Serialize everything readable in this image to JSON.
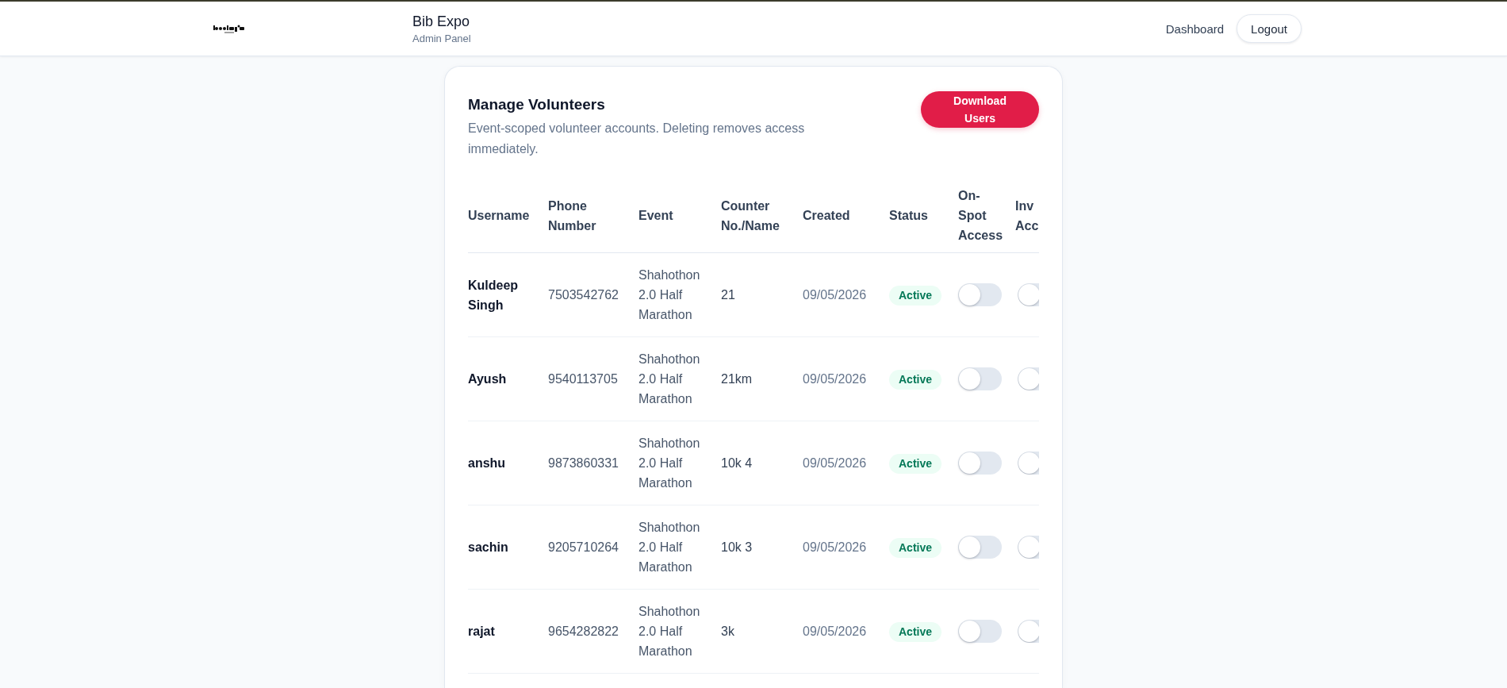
{
  "header": {
    "brand_title": "Bib Expo",
    "brand_subtitle": "Admin Panel",
    "nav_links": [
      {
        "label": "Dashboard"
      }
    ],
    "logout_button": "Logout"
  },
  "card": {
    "title": "Manage Volunteers",
    "description": "Event-scoped volunteer accounts. Deleting removes access immediately.",
    "download_button": "Download Users"
  },
  "table": {
    "columns": [
      "Username",
      "Phone Number",
      "Event",
      "Counter No./Name",
      "Created",
      "Status",
      "On-Spot Access",
      "Inv Acc"
    ],
    "rows": [
      {
        "username": "Kuldeep Singh",
        "phone": "7503542762",
        "event": "Shahothon 2.0 Half Marathon",
        "counter": "21",
        "created": "09/05/2026",
        "status": "Active",
        "on_spot_access": false,
        "column_8": false
      },
      {
        "username": "Ayush",
        "phone": "9540113705",
        "event": "Shahothon 2.0 Half Marathon",
        "counter": "21km",
        "created": "09/05/2026",
        "status": "Active",
        "on_spot_access": false,
        "column_8": false
      },
      {
        "username": "anshu",
        "phone": "9873860331",
        "event": "Shahothon 2.0 Half Marathon",
        "counter": "10k 4",
        "created": "09/05/2026",
        "status": "Active",
        "on_spot_access": false,
        "column_8": false
      },
      {
        "username": "sachin",
        "phone": "9205710264",
        "event": "Shahothon 2.0 Half Marathon",
        "counter": "10k 3",
        "created": "09/05/2026",
        "status": "Active",
        "on_spot_access": false,
        "column_8": false
      },
      {
        "username": "rajat",
        "phone": "9654282822",
        "event": "Shahothon 2.0 Half Marathon",
        "counter": "3k",
        "created": "09/05/2026",
        "status": "Active",
        "on_spot_access": false,
        "column_8": false
      }
    ]
  }
}
